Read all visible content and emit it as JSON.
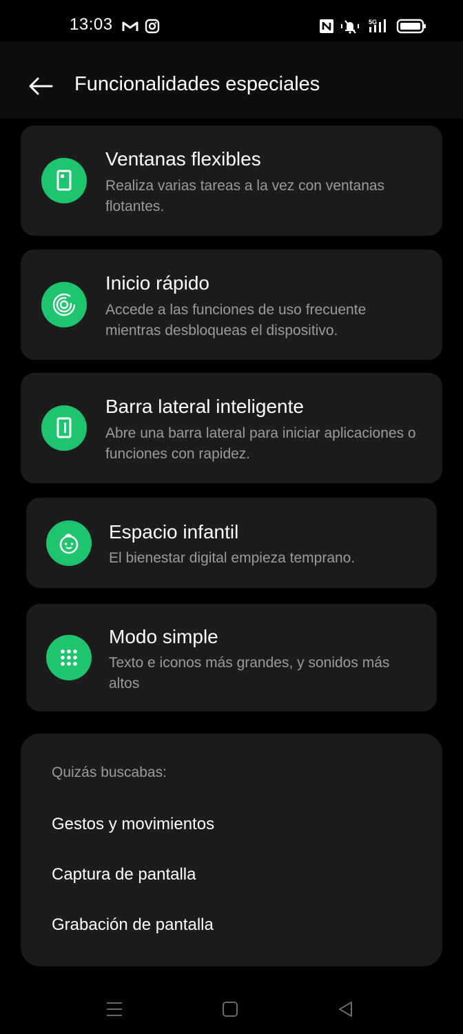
{
  "status_bar": {
    "time": "13:03",
    "icons": [
      "gmail-icon",
      "instagram-icon",
      "nfc-icon",
      "vibrate-mute-icon",
      "signal-5g-icon",
      "battery-icon"
    ]
  },
  "header": {
    "title": "Funcionalidades especiales",
    "back_icon": "back-arrow-icon"
  },
  "features": [
    {
      "title": "Ventanas flexibles",
      "desc_lines": [
        "Realiza varias tareas a la vez con ventanas",
        "flotantes."
      ],
      "icon": "flexible-window-icon"
    },
    {
      "title": "Inicio rápido",
      "desc_lines": [
        "Accede a las funciones de uso frecuente",
        "mientras desbloqueas el dispositivo."
      ],
      "icon": "fingerprint-icon"
    },
    {
      "title": "Barra lateral inteligente",
      "desc_lines": [
        "Abre una barra lateral para iniciar aplicaciones o",
        "funciones con rapidez."
      ],
      "icon": "sidebar-icon"
    },
    {
      "title": "Espacio infantil",
      "desc_lines": [
        "El bienestar digital empieza temprano."
      ],
      "icon": "kid-face-icon"
    },
    {
      "title": "Modo simple",
      "desc_lines": [
        "Texto e iconos más grandes, y sonidos más",
        "altos"
      ],
      "icon": "grid-dots-icon"
    }
  ],
  "suggestions": {
    "header": "Quizás buscabas:",
    "items": [
      "Gestos y movimientos",
      "Captura de pantalla",
      "Grabación de pantalla"
    ]
  },
  "nav_bar": {
    "icons": [
      "menu-icon",
      "home-square-icon",
      "back-triangle-icon"
    ]
  },
  "colors": {
    "accent": "#1fc46f",
    "card_bg": "#1c1c1c",
    "background": "#000000",
    "secondary_text": "#9b9b9b"
  }
}
